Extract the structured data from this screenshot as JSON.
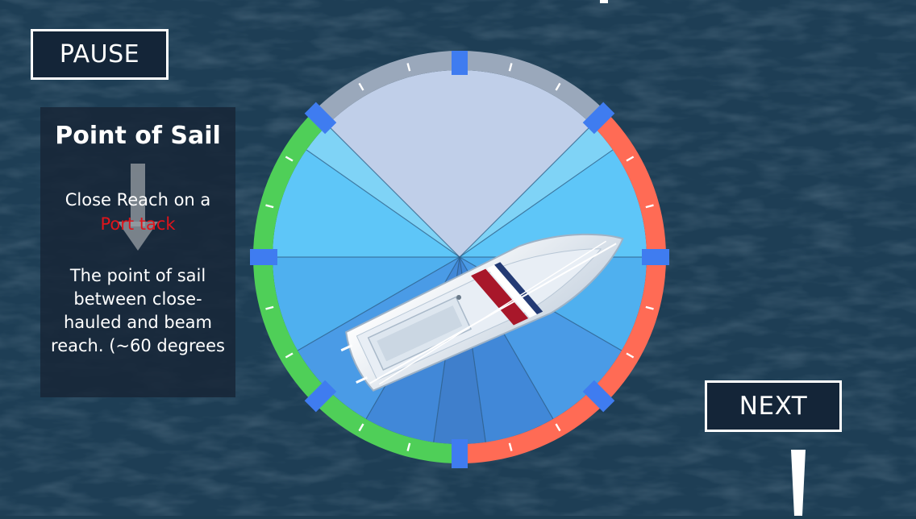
{
  "hud": {
    "pause_label": "PAUSE",
    "next_label": "NEXT"
  },
  "info_panel": {
    "title": "Point of Sail",
    "subtitle_line": "Close Reach on a",
    "tack": "Port tack",
    "description": "The point of sail between close-hauled and beam reach. (~60 degrees"
  },
  "icons": {
    "arrow": "down-arrow-icon",
    "boat": "sailboat-icon"
  },
  "colors": {
    "starboard_ring": "#4fcf58",
    "port_ring": "#ff6b55",
    "no_go_ring": "#9aa8bb",
    "marker": "#3f7cf0",
    "tack_text": "#e0141b",
    "panel_bg": "#172536"
  }
}
